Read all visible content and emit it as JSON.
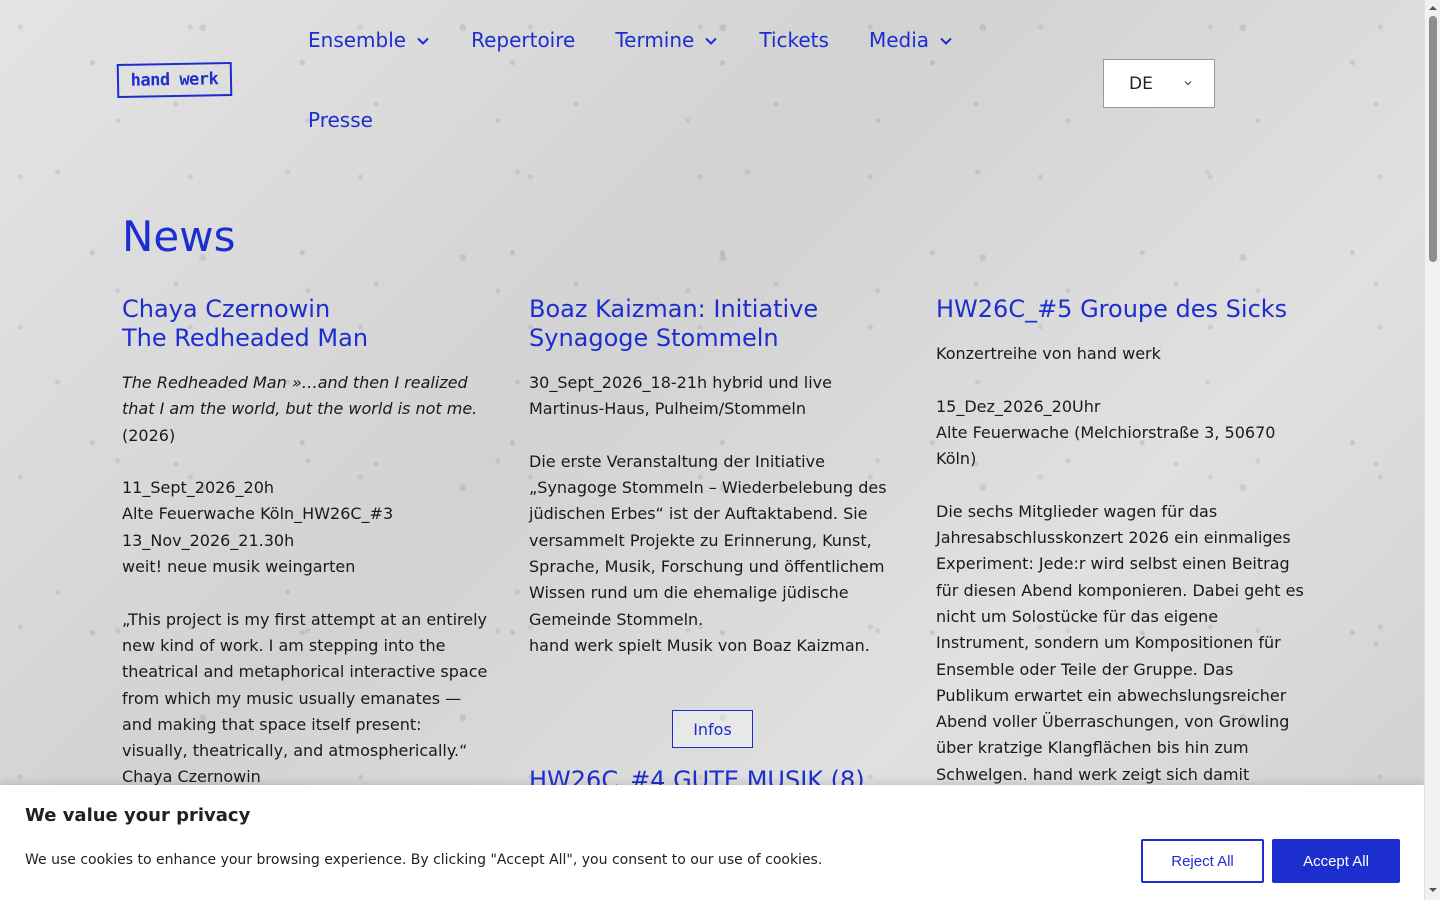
{
  "header": {
    "logo_text": "hand werk",
    "nav": [
      {
        "label": "Ensemble",
        "has_dropdown": true
      },
      {
        "label": "Repertoire",
        "has_dropdown": false
      },
      {
        "label": "Termine",
        "has_dropdown": true
      },
      {
        "label": "Tickets",
        "has_dropdown": false
      },
      {
        "label": "Media",
        "has_dropdown": true
      },
      {
        "label": "Presse",
        "has_dropdown": false
      }
    ],
    "language": {
      "selected": "DE"
    }
  },
  "main": {
    "heading": "News",
    "posts": [
      {
        "title_line1": "Chaya Czernowin",
        "title_line2": "The Redheaded Man",
        "intro_italic": "The Redheaded Man »…and then I realized that I am the world, but the world is not me.",
        "intro_year": " (2026)",
        "dates": [
          "11_Sept_2026_20h",
          "Alte Feuerwache Köln_HW26C_#3",
          "13_Nov_2026_21.30h",
          "weit! neue musik weingarten"
        ],
        "quote": "„This project is my first attempt at an entirely new kind of work. I am stepping into the theatrical and metaphorical interactive space from which my music usually emanates — and making that space itself present: visually, theatrically, and atmospherically.“",
        "author": "Chaya Czernowin"
      },
      {
        "title_line1": "Boaz Kaizman: Initiative",
        "title_line2": "Synagoge Stommeln",
        "dates": [
          "30_Sept_2026_18-21h hybrid und live",
          "Martinus-Haus, Pulheim/Stommeln"
        ],
        "description": "Die erste Veranstaltung der Initiative „Synagoge Stommeln – Wiederbelebung des jüdischen Erbes“ ist der Auftaktabend. Sie versammelt Projekte zu Erinnerung, Kunst, Sprache, Musik, Forschung und öffentlichem Wissen rund um die ehemalige jüdische Gemeinde Stommeln.",
        "note": "hand werk spielt Musik von Boaz Kaizman.",
        "button_label": "Infos"
      },
      {
        "title_line1": "HW26C_#5 Groupe des Sicks",
        "subtitle": "Konzertreihe von hand werk",
        "dates": [
          "15_Dez_2026_20Uhr",
          "Alte Feuerwache (Melchiorstraße 3, 50670 Köln)"
        ],
        "description": "Die sechs Mitglieder wagen für das Jahresabschlusskonzert 2026 ein einmaliges Experiment: Jede:r wird selbst einen Beitrag für diesen Abend komponieren. Dabei geht es nicht um Solostücke für das eigene Instrument, sondern um Kompositionen für Ensemble oder Teile der Gruppe. Das Publikum erwartet ein abwechslungsreicher Abend voller Überraschungen, von Growling über kratzige Klangflächen bis hin zum Schwelgen. hand werk zeigt sich damit"
      }
    ],
    "next_post_title": "HW26C_#4 GUTE MUSIK (8)"
  },
  "cookie_banner": {
    "title": "We value your privacy",
    "text": "We use cookies to enhance your browsing experience. By clicking \"Accept All\", you consent to our use of cookies.",
    "reject_label": "Reject All",
    "accept_label": "Accept All"
  },
  "colors": {
    "accent": "#1d2ecf",
    "background": "#dcdcdc",
    "banner": "#ffffff"
  },
  "icons": [
    "chevron-down-icon",
    "scroll-up-icon",
    "scroll-down-icon"
  ]
}
